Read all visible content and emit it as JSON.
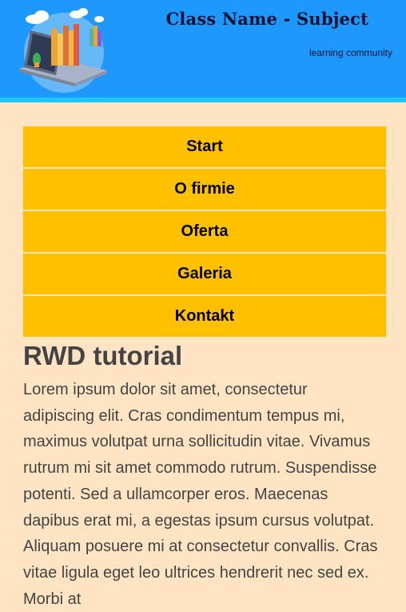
{
  "header": {
    "title": "Class Name - Subject",
    "tagline": "learning community",
    "logo_icon": "laptop-books-illustration-icon",
    "background_color": "#1e98fd",
    "border_color": "#1ec8ff"
  },
  "nav": {
    "items": [
      {
        "label": "Start"
      },
      {
        "label": "O firmie"
      },
      {
        "label": "Oferta"
      },
      {
        "label": "Galeria"
      },
      {
        "label": "Kontakt"
      }
    ],
    "item_color": "#ffc000"
  },
  "main": {
    "heading": "RWD tutorial",
    "body": "Lorem ipsum dolor sit amet, consectetur adipiscing elit. Cras condimentum tempus mi, maximus volutpat urna sollicitudin vitae. Vivamus rutrum mi sit amet commodo rutrum. Suspendisse potenti. Sed a ullamcorper eros. Maecenas dapibus erat mi, a egestas ipsum cursus volutpat. Aliquam posuere mi at consectetur convallis. Cras vitae ligula eget leo ultrices hendrerit nec sed ex. Morbi at"
  },
  "page": {
    "background_color": "#ffe4c4"
  }
}
